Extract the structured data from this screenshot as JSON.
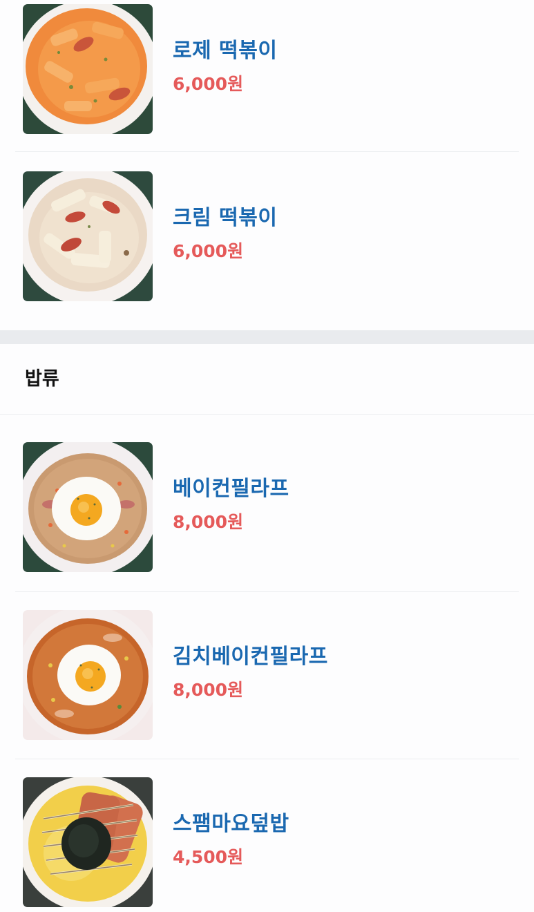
{
  "section_top": {
    "items": [
      {
        "name": "로제 떡볶이",
        "price": "6,000원",
        "image": "rose-tteokbokki-photo"
      },
      {
        "name": "크림 떡볶이",
        "price": "6,000원",
        "image": "cream-tteokbokki-photo"
      }
    ]
  },
  "section_rice": {
    "title": "밥류",
    "items": [
      {
        "name": "베이컨필라프",
        "price": "8,000원",
        "image": "bacon-pilaf-photo"
      },
      {
        "name": "김치베이컨필라프",
        "price": "8,000원",
        "image": "kimchi-bacon-pilaf-photo"
      },
      {
        "name": "스팸마요덮밥",
        "price": "4,500원",
        "image": "spam-mayo-rice-bowl-photo"
      }
    ]
  },
  "colors": {
    "item_name": "#1a68b0",
    "price": "#e55a5a",
    "divider_band": "#e9ebee"
  }
}
